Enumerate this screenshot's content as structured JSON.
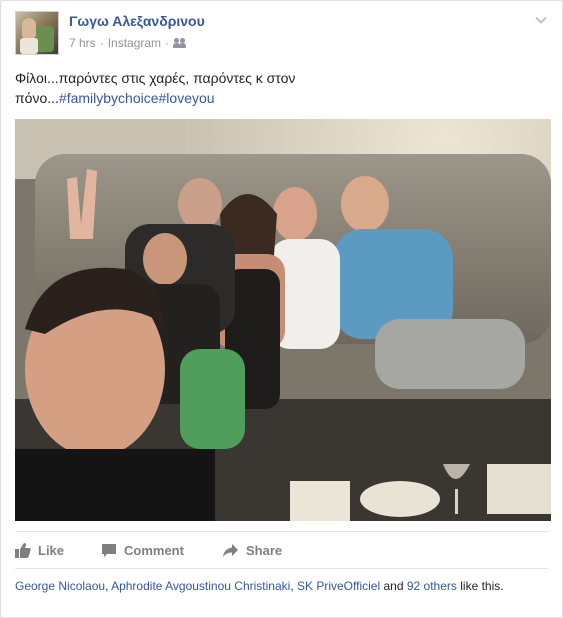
{
  "post": {
    "author": "Γωγω Αλεξανδρινου",
    "time": "7 hrs",
    "source": "Instagram",
    "audience_icon": "friends-icon",
    "menu_icon": "chevron-down-icon",
    "text_lead": "Φίλοι...παρόντες στις χαρές, παρόντες κ στον πόνο...",
    "hashtag_1": "#familybychoice",
    "hashtag_2": "#loveyou"
  },
  "photo": {
    "alt_icon": "group-selfie-photo"
  },
  "actions": {
    "like": "Like",
    "comment": "Comment",
    "share": "Share"
  },
  "likes": {
    "name_1": "George Nicolaou",
    "name_2": "Aphrodite Avgoustinou Christinaki",
    "name_3": "SK PriveOfficiel",
    "and": "and",
    "others": "92 others",
    "suffix": "like this."
  },
  "colors": {
    "link": "#365899",
    "meta": "#90949c",
    "action": "#7f7f7f"
  }
}
